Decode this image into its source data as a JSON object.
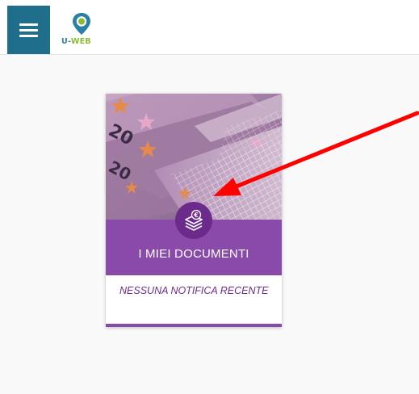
{
  "header": {
    "logo": {
      "part1": "U-",
      "part2": "WEB"
    }
  },
  "card": {
    "title": "I MIEI DOCUMENTI",
    "notification": "NESSUNA NOTIFICA RECENTE"
  },
  "colors": {
    "menu_button": "#1f6e8c",
    "card_band": "#8a4aa9",
    "card_icon": "#6c2b8b",
    "notification_text": "#6d2d8f",
    "annotation_arrow": "#ff0000",
    "logo_blue": "#2a7fa5",
    "logo_green": "#8dbb2f"
  },
  "icons": {
    "menu": "hamburger-menu-icon",
    "logo": "location-pin-icon",
    "card": "stacked-documents-euro-icon"
  }
}
